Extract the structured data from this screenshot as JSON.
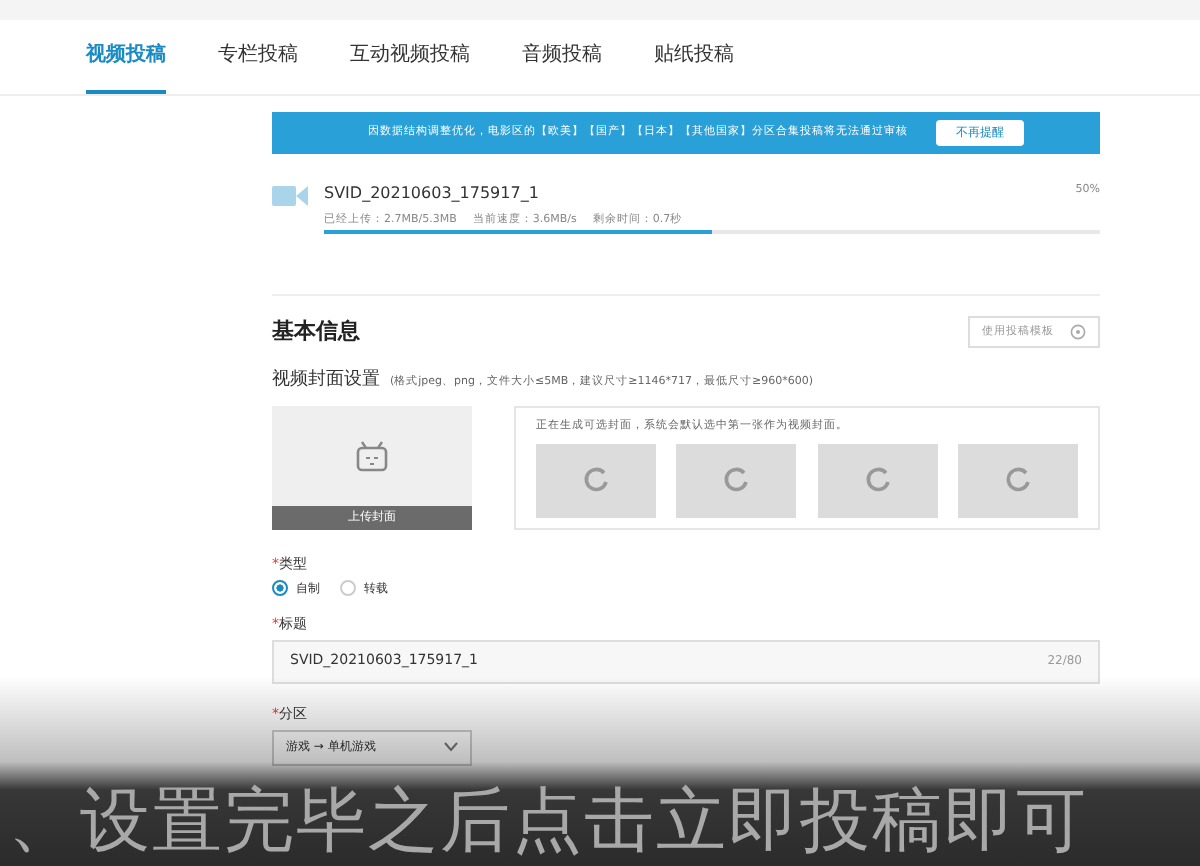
{
  "tabs": [
    {
      "label": "视频投稿",
      "selected": true
    },
    {
      "label": "专栏投稿",
      "selected": false
    },
    {
      "label": "互动视频投稿",
      "selected": false
    },
    {
      "label": "音频投稿",
      "selected": false
    },
    {
      "label": "贴纸投稿",
      "selected": false
    }
  ],
  "notice": {
    "text": "因数据结构调整优化，电影区的【欧美】【国产】【日本】【其他国家】分区合集投稿将无法通过审核",
    "button": "不再提醒"
  },
  "upload": {
    "filename": "SVID_20210603_175917_1",
    "percent": "50%",
    "uploaded": "已经上传：2.7MB/5.3MB",
    "speed": "当前速度：3.6MB/s",
    "remaining": "剩余时间：0.7秒",
    "level": 0.5
  },
  "section_title": "基本信息",
  "template_button": "使用投稿模板",
  "cover": {
    "label": "视频封面设置",
    "hint": "(格式jpeg、png，文件大小≤5MB，建议尺寸≥1146*717，最低尺寸≥960*600)",
    "upload_label": "上传封面",
    "generating": "正在生成可选封面，系统会默认选中第一张作为视频封面。"
  },
  "type": {
    "required_mark": "*",
    "label": "类型",
    "options": [
      {
        "label": "自制",
        "selected": true
      },
      {
        "label": "转载",
        "selected": false
      }
    ]
  },
  "title": {
    "required_mark": "*",
    "label": "标题",
    "value": "SVID_20210603_175917_1",
    "counter": "22/80"
  },
  "category": {
    "required_mark": "*",
    "label": "分区",
    "value": "游戏 → 单机游戏"
  },
  "subtitle": "、设置完毕之后点击立即投稿即可"
}
